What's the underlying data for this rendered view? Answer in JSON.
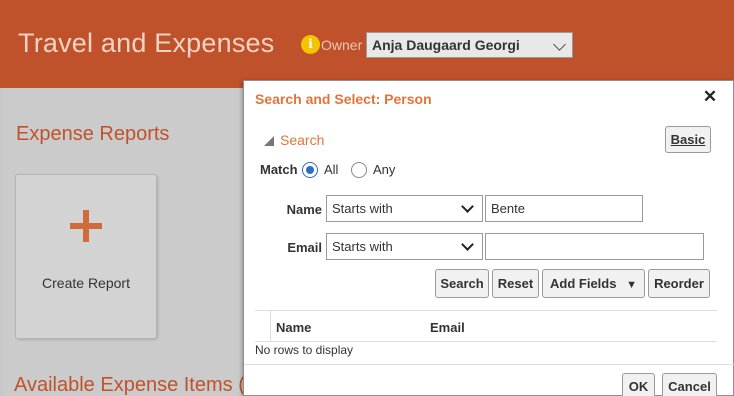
{
  "header": {
    "title": "Travel and Expenses",
    "info_icon_glyph": "i",
    "owner_label": "Owner",
    "owner_value": "Anja Daugaard Georgi"
  },
  "page": {
    "expense_reports_title": "Expense Reports",
    "create_report_label": "Create Report",
    "available_items_title": "Available Expense Items ("
  },
  "dialog": {
    "title": "Search and Select: Person",
    "close_glyph": "✕",
    "search_toggle_label": "Search",
    "basic_button_label": "Basic",
    "match_label": "Match",
    "match_options": [
      {
        "label": "All",
        "selected": true
      },
      {
        "label": "Any",
        "selected": false
      }
    ],
    "fields": [
      {
        "label": "Name",
        "operator": "Starts with",
        "value": "Bente"
      },
      {
        "label": "Email",
        "operator": "Starts with",
        "value": ""
      }
    ],
    "actions": {
      "search": "Search",
      "reset": "Reset",
      "add_fields": "Add Fields",
      "add_fields_arrow": "▼",
      "reorder": "Reorder"
    },
    "table": {
      "columns": [
        "Name",
        "Email"
      ],
      "empty_message": "No rows to display"
    },
    "footer": {
      "ok": "OK",
      "cancel": "Cancel"
    }
  },
  "colors": {
    "brand": "#c0522b",
    "accent": "#e4733a",
    "info": "#f4c400",
    "radio_selected": "#2a6ec6"
  }
}
